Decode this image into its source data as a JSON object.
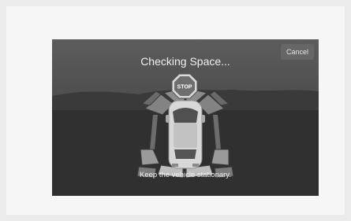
{
  "screen": {
    "title": "Checking Space...",
    "cancel_label": "Cancel",
    "stop_label": "STOP",
    "message": "Keep the vehicle stationary."
  }
}
